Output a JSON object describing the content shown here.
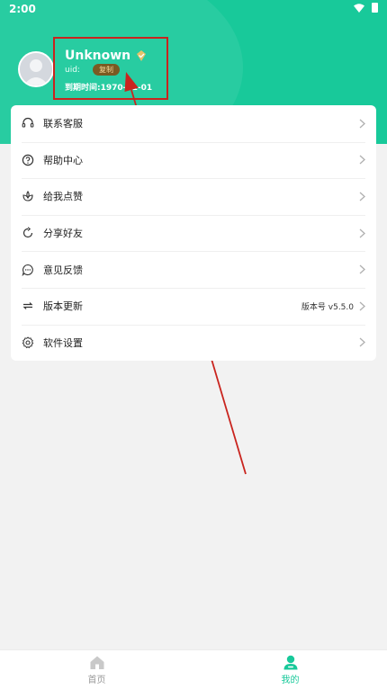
{
  "status_bar": {
    "time": "2:00"
  },
  "profile": {
    "username": "Unknown",
    "uid_label": "uid:",
    "copy_label": "复制",
    "expire_text": "到期时间:1970-01-01"
  },
  "menu": {
    "items": [
      {
        "label": "联系客服",
        "icon": "headset-icon"
      },
      {
        "label": "帮助中心",
        "icon": "help-circle-icon"
      },
      {
        "label": "给我点赞",
        "icon": "flower-icon"
      },
      {
        "label": "分享好友",
        "icon": "share-refresh-icon"
      },
      {
        "label": "意见反馈",
        "icon": "chat-bubble-icon"
      },
      {
        "label": "版本更新",
        "icon": "sync-arrows-icon",
        "extra": "版本号 v5.5.0"
      },
      {
        "label": "软件设置",
        "icon": "gear-icon"
      }
    ]
  },
  "tabbar": {
    "home_label": "首页",
    "mine_label": "我的"
  },
  "colors": {
    "brand": "#18c99a",
    "annotation": "#c9241e",
    "copy_bg": "#7a5a22"
  }
}
